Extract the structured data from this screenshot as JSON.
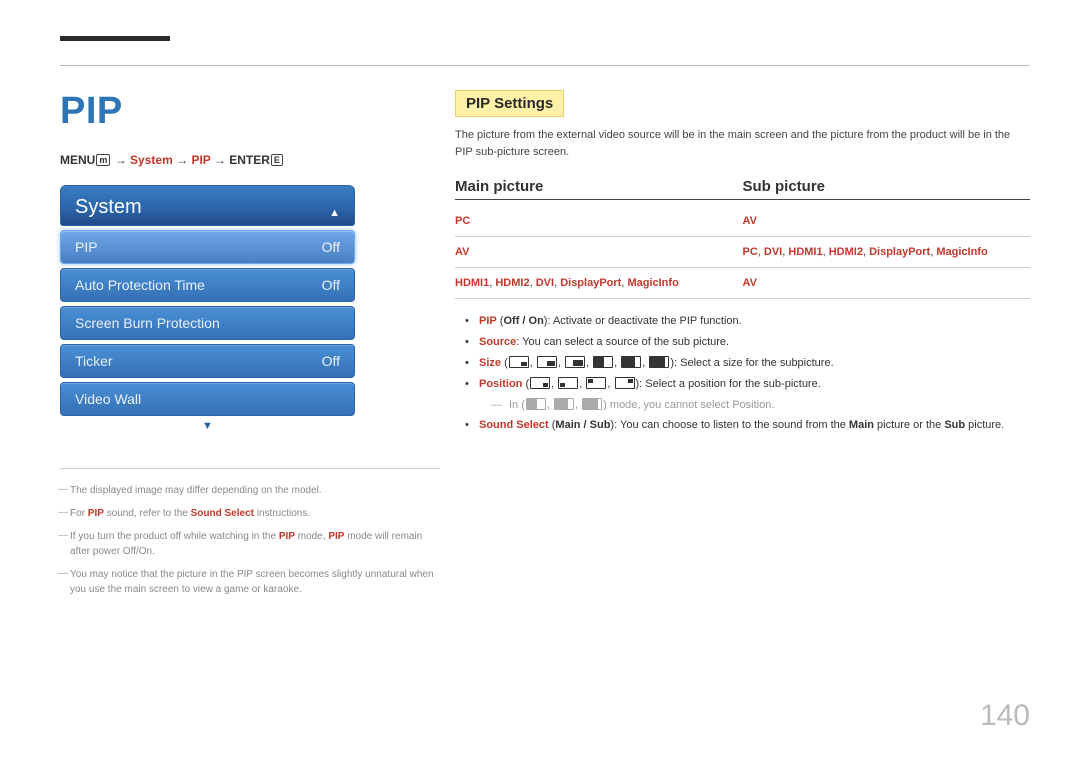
{
  "heading": "PIP",
  "breadcrumb": {
    "menu": "MENU",
    "arrow": "→",
    "system": "System",
    "pip": "PIP",
    "enter": "ENTER"
  },
  "menu": {
    "title": "System",
    "items": [
      {
        "label": "PIP",
        "value": "Off",
        "selected": true
      },
      {
        "label": "Auto Protection Time",
        "value": "Off",
        "selected": false
      },
      {
        "label": "Screen Burn Protection",
        "value": "",
        "selected": false
      },
      {
        "label": "Ticker",
        "value": "Off",
        "selected": false
      },
      {
        "label": "Video Wall",
        "value": "",
        "selected": false
      }
    ]
  },
  "notes": {
    "n1": "The displayed image may differ depending on the model.",
    "n2_a": "For ",
    "n2_b": "PIP",
    "n2_c": " sound, refer to the ",
    "n2_d": "Sound Select",
    "n2_e": " instructions.",
    "n3_a": "If you turn the product off while watching in the ",
    "n3_b": "PIP",
    "n3_c": " mode, ",
    "n3_d": "PIP",
    "n3_e": " mode will remain after power Off/On.",
    "n4": "You may notice that the picture in the PIP screen becomes slightly unnatural when you use the main screen to view a game or karaoke."
  },
  "right": {
    "hl": "PIP Settings",
    "intro": "The picture from the external video source will be in the main screen and the picture from the product will be in the PIP sub-picture screen.",
    "thead_main": "Main picture",
    "thead_sub": "Sub picture",
    "rows": [
      {
        "main": "PC",
        "sub": "AV"
      },
      {
        "main": "AV",
        "sub_parts": [
          "PC",
          "DVI",
          "HDMI1",
          "HDMI2",
          "DisplayPort",
          "MagicInfo"
        ]
      },
      {
        "main_parts": [
          "HDMI1",
          "HDMI2",
          "DVI",
          "DisplayPort",
          "MagicInfo"
        ],
        "sub": "AV"
      }
    ],
    "bul": {
      "pip_label": "PIP",
      "pip_opts": "Off / On",
      "pip_desc": ": Activate or deactivate the PIP function.",
      "source_label": "Source",
      "source_desc": ": You can select a source of the sub picture.",
      "size_label": "Size",
      "size_desc": ": Select a size for the subpicture.",
      "pos_label": "Position",
      "pos_desc": ": Select a position for the sub-picture.",
      "pos_note_a": "In",
      "pos_note_b": "mode, you cannot select",
      "pos_note_c": "Position",
      "ss_label": "Sound Select",
      "ss_opts": "Main / Sub",
      "ss_desc_a": ": You can choose to listen to the sound from the ",
      "ss_desc_b": "Main",
      "ss_desc_c": " picture or the ",
      "ss_desc_d": "Sub",
      "ss_desc_e": " picture."
    }
  },
  "pagenum": "140"
}
